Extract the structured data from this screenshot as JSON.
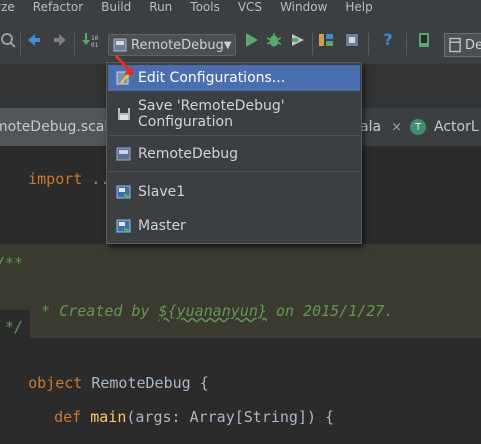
{
  "menubar": {
    "items": [
      "yze",
      "Refactor",
      "Build",
      "Run",
      "Tools",
      "VCS",
      "Window",
      "Help"
    ]
  },
  "toolbar": {
    "run_config": "RemoteDebug",
    "right_button": "De"
  },
  "tabs": [
    {
      "label": "moteDebug.scala",
      "active": true
    },
    {
      "label": "ala",
      "active": false
    },
    {
      "label": "ActorL",
      "active": false
    }
  ],
  "popup": {
    "items": [
      {
        "label": "Edit Configurations...",
        "selected": true
      },
      {
        "label": "Save 'RemoteDebug' Configuration",
        "selected": false
      },
      {
        "label": "RemoteDebug",
        "selected": false
      },
      {
        "label": "Slave1",
        "selected": false
      },
      {
        "label": "Master",
        "selected": false
      }
    ]
  },
  "editor": {
    "import_line": "import ...",
    "doc_open": "/**",
    "doc_created_prefix": " * Created by ",
    "doc_created_author": "${yuananyun}",
    "doc_created_suffix": " on 2015/1/27.",
    "doc_close": " */",
    "object_kw": "object",
    "object_name": " RemoteDebug {",
    "def_kw": "def",
    "def_name": " main",
    "def_args": "(args: Array[String]) {"
  },
  "colors": {
    "accent_selection": "#4b6eaf",
    "keyword": "#cc7832",
    "doc_comment": "#629755",
    "run_green": "#59a869",
    "arrow_red": "#e0302a"
  }
}
